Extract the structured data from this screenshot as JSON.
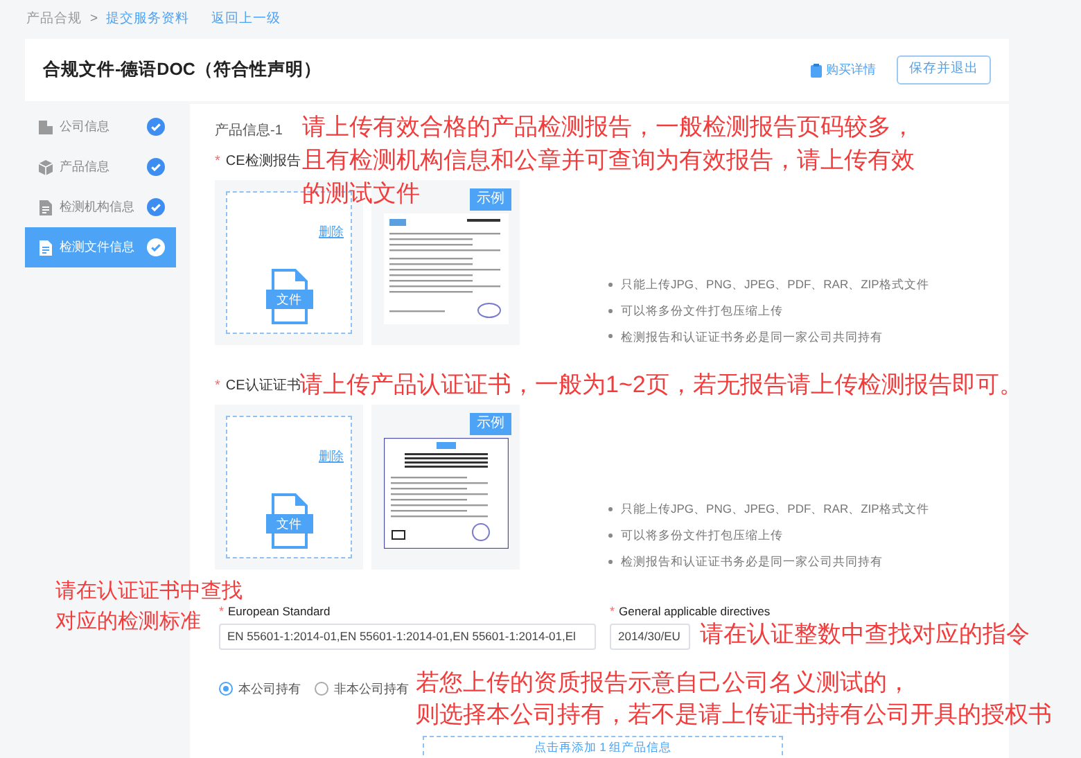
{
  "breadcrumb": {
    "items": [
      "产品合规",
      "提交服务资料"
    ],
    "separator": ">",
    "back": "返回上一级"
  },
  "header": {
    "title": "合规文件-德语DOC（符合性声明）",
    "purchase_link": "购买详情",
    "save_button": "保存并退出"
  },
  "sidebar": {
    "items": [
      {
        "label": "公司信息",
        "done": true,
        "selected": false
      },
      {
        "label": "产品信息",
        "done": true,
        "selected": false
      },
      {
        "label": "检测机构信息",
        "done": true,
        "selected": false
      },
      {
        "label": "检测文件信息",
        "done": true,
        "selected": true
      }
    ]
  },
  "product": {
    "title": "产品信息-1",
    "uploads": [
      {
        "label": "CE检测报告",
        "required_mark": "*",
        "file_label": "文件",
        "delete": "删除",
        "sample_badge": "示例",
        "tips": [
          "只能上传JPG、PNG、JPEG、PDF、RAR、ZIP格式文件",
          "可以将多份文件打包压缩上传",
          "检测报告和认证证书务必是同一家公司共同持有"
        ]
      },
      {
        "label": "CE认证证书",
        "required_mark": "*",
        "file_label": "文件",
        "delete": "删除",
        "sample_badge": "示例",
        "tips": [
          "只能上传JPG、PNG、JPEG、PDF、RAR、ZIP格式文件",
          "可以将多份文件打包压缩上传",
          "检测报告和认证证书务必是同一家公司共同持有"
        ]
      }
    ],
    "fields": [
      {
        "label": "European Standard",
        "required_mark": "*",
        "value": "EN 55601-1:2014-01,EN 55601-1:2014-01,EN 55601-1:2014-01,El"
      },
      {
        "label": "General applicable directives",
        "required_mark": "*",
        "value": "2014/30/EU"
      }
    ],
    "ownership": [
      {
        "label": "本公司持有",
        "selected": true
      },
      {
        "label": "非本公司持有",
        "selected": false
      }
    ],
    "add_more": "点击再添加 1 组产品信息"
  },
  "annotations": [
    {
      "lines": [
        "请上传有效合格的产品检测报告，一般检测报告页码较多，",
        "且有检测机构信息和公章并可查询为有效报告，请上传有效",
        "的测试文件"
      ]
    },
    {
      "lines": [
        "请上传产品认证证书，一般为1~2页，若无报告请上传检测报告即可。"
      ]
    },
    {
      "lines": [
        "请在认证证书中查找",
        "对应的检测标准"
      ]
    },
    {
      "lines": [
        "请在认证整数中查找对应的指令"
      ]
    },
    {
      "lines": [
        "若您上传的资质报告示意自己公司名义测试的，",
        "则选择本公司持有，若不是请上传证书持有公司开具的授权书"
      ]
    }
  ]
}
